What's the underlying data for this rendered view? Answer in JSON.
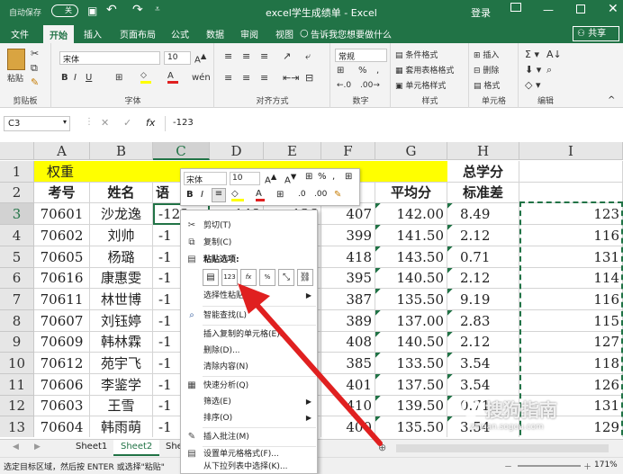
{
  "titlebar": {
    "autosave": "自动保存",
    "autosave_state": "关",
    "title": "excel学生成绩单 - Excel",
    "login": "登录"
  },
  "ribbon_tabs": [
    "文件",
    "开始",
    "插入",
    "页面布局",
    "公式",
    "数据",
    "审阅",
    "视图"
  ],
  "tell_me": "告诉我您想要做什么",
  "share": "共享",
  "ribbon": {
    "paste": "粘贴",
    "clipboard": "剪贴板",
    "font_name": "宋体",
    "font_size": "10",
    "font_group": "字体",
    "alignment_group": "对齐方式",
    "number_format": "常规",
    "number_group": "数字",
    "cond_format": "条件格式",
    "table_format": "套用表格格式",
    "cell_style": "单元格样式",
    "style_group": "样式",
    "insert": "插入",
    "delete": "删除",
    "format": "格式",
    "cells_group": "单元格",
    "edit_group": "编辑"
  },
  "formula_bar": {
    "name_box": "C3",
    "fx": "fx",
    "value": "-123"
  },
  "columns": [
    "A",
    "B",
    "C",
    "D",
    "E",
    "F",
    "G",
    "H",
    "I"
  ],
  "rows": [
    {
      "n": "1",
      "cells": [
        "权重",
        "",
        "",
        "",
        "",
        "",
        "",
        "总学分",
        ""
      ]
    },
    {
      "n": "2",
      "cells": [
        "考号",
        "姓名",
        "语",
        "",
        "",
        "",
        "平均分",
        "标准差",
        ""
      ]
    },
    {
      "n": "3",
      "cells": [
        "70601",
        "沙龙逸",
        "-123",
        "148",
        "136",
        "407",
        "142.00",
        "8.49",
        "123"
      ]
    },
    {
      "n": "4",
      "cells": [
        "70602",
        "刘帅",
        "-1",
        "",
        "",
        "399",
        "141.50",
        "2.12",
        "116"
      ]
    },
    {
      "n": "5",
      "cells": [
        "70605",
        "杨璐",
        "-1",
        "",
        "",
        "418",
        "143.50",
        "0.71",
        "131"
      ]
    },
    {
      "n": "6",
      "cells": [
        "70616",
        "康惠雯",
        "-1",
        "",
        "",
        "395",
        "140.50",
        "2.12",
        "114"
      ]
    },
    {
      "n": "7",
      "cells": [
        "70611",
        "林世博",
        "-1",
        "",
        "",
        "387",
        "135.50",
        "9.19",
        "116"
      ]
    },
    {
      "n": "8",
      "cells": [
        "70607",
        "刘钰婷",
        "-1",
        "",
        "",
        "389",
        "137.00",
        "2.83",
        "115"
      ]
    },
    {
      "n": "9",
      "cells": [
        "70609",
        "韩林霖",
        "-1",
        "",
        "",
        "408",
        "140.50",
        "2.12",
        "127"
      ]
    },
    {
      "n": "10",
      "cells": [
        "70612",
        "苑宇飞",
        "-1",
        "",
        "",
        "385",
        "133.50",
        "3.54",
        "118"
      ]
    },
    {
      "n": "11",
      "cells": [
        "70606",
        "李鉴学",
        "-1",
        "",
        "",
        "401",
        "137.50",
        "3.54",
        "126"
      ]
    },
    {
      "n": "12",
      "cells": [
        "70603",
        "王雪",
        "-1",
        "",
        "",
        "410",
        "139.50",
        "0.71",
        "131"
      ]
    },
    {
      "n": "13",
      "cells": [
        "70604",
        "韩雨萌",
        "-1",
        "",
        "",
        "400",
        "135.50",
        "3.54",
        "129"
      ]
    }
  ],
  "mini_toolbar": {
    "font": "宋体",
    "size": "10",
    "bold": "B",
    "italic": "I",
    "percent": "%",
    "comma": ","
  },
  "context_menu": {
    "items": [
      {
        "label": "剪切(T)",
        "icon": "scissors-icon"
      },
      {
        "label": "复制(C)",
        "icon": "copy-icon"
      },
      {
        "label": "粘贴选项:",
        "icon": "paste-icon"
      },
      {
        "label": "选择性粘贴(S)...",
        "icon": ""
      },
      {
        "label": "智能查找(L)",
        "icon": "search-icon"
      },
      {
        "label": "插入复制的单元格(E)...",
        "icon": ""
      },
      {
        "label": "删除(D)...",
        "icon": ""
      },
      {
        "label": "清除内容(N)",
        "icon": ""
      },
      {
        "label": "快速分析(Q)",
        "icon": "quick-analysis-icon"
      },
      {
        "label": "筛选(E)",
        "icon": ""
      },
      {
        "label": "排序(O)",
        "icon": ""
      },
      {
        "label": "插入批注(M)",
        "icon": "comment-icon"
      },
      {
        "label": "设置单元格格式(F)...",
        "icon": "format-cells-icon"
      },
      {
        "label": "从下拉列表中选择(K)...",
        "icon": ""
      }
    ],
    "paste_option_labels": [
      "",
      "123",
      "fx",
      "%",
      "",
      ""
    ]
  },
  "sheets": [
    "Sheet1",
    "Sheet2",
    "She"
  ],
  "status": {
    "message": "选定目标区域，然后按 ENTER 或选择\"粘贴\"",
    "zoom": "171%"
  },
  "watermark": {
    "text": "搜狗指南",
    "url": "zhinan.sogou.com"
  },
  "colors": {
    "excel_green": "#217346",
    "header_yellow": "#ffff00",
    "arrow_red": "#e02020"
  }
}
